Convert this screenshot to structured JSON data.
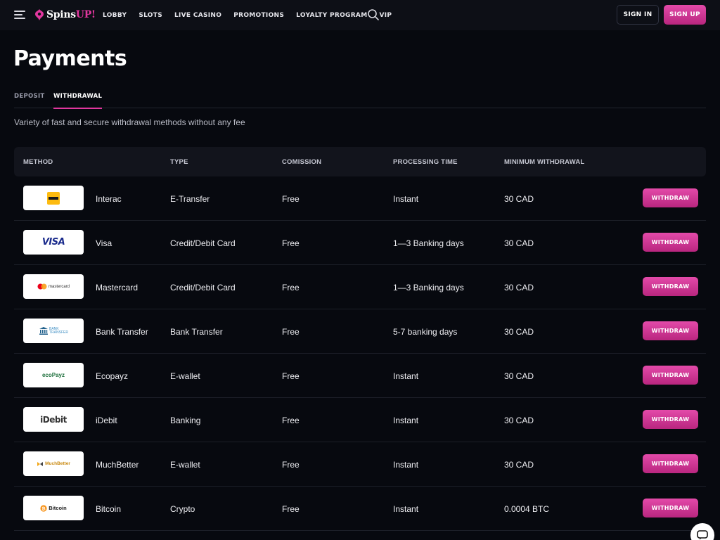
{
  "brand": {
    "name_part1": "Spins",
    "name_part2": "UP!",
    "accent": "#e1379e"
  },
  "nav": [
    "LOBBY",
    "SLOTS",
    "LIVE CASINO",
    "PROMOTIONS",
    "LOYALTY PROGRAM",
    "VIP"
  ],
  "header": {
    "sign_in": "SIGN IN",
    "sign_up": "SIGN UP"
  },
  "page": {
    "title": "Payments",
    "tabs": [
      "DEPOSIT",
      "WITHDRAWAL"
    ],
    "active_tab": "WITHDRAWAL",
    "subtitle": "Variety of fast and secure withdrawal methods without any fee"
  },
  "table": {
    "headers": [
      "METHOD",
      "TYPE",
      "COMISSION",
      "PROCESSING TIME",
      "MINIMUM WITHDRAWAL"
    ],
    "button_label": "WITHDRAW",
    "rows": [
      {
        "name": "Interac",
        "type": "E-Transfer",
        "commission": "Free",
        "time": "Instant",
        "min": "30 CAD",
        "logo": "interac-logo"
      },
      {
        "name": "Visa",
        "type": "Credit/Debit Card",
        "commission": "Free",
        "time": "1—3 Banking days",
        "min": "30 CAD",
        "logo": "visa-logo",
        "logo_text": "VISA"
      },
      {
        "name": "Mastercard",
        "type": "Credit/Debit Card",
        "commission": "Free",
        "time": "1—3 Banking days",
        "min": "30 CAD",
        "logo": "mastercard-logo",
        "logo_text": "mastercard"
      },
      {
        "name": "Bank Transfer",
        "type": "Bank Transfer",
        "commission": "Free",
        "time": "5-7 banking days",
        "min": "30 CAD",
        "logo": "bank-transfer-logo",
        "logo_text": "BANK TRANSFER"
      },
      {
        "name": "Ecopayz",
        "type": "E-wallet",
        "commission": "Free",
        "time": "Instant",
        "min": "30 CAD",
        "logo": "ecopayz-logo",
        "logo_text": "ecoPayz"
      },
      {
        "name": "iDebit",
        "type": "Banking",
        "commission": "Free",
        "time": "Instant",
        "min": "30 CAD",
        "logo": "idebit-logo",
        "logo_text": "iDebit"
      },
      {
        "name": "MuchBetter",
        "type": "E-wallet",
        "commission": "Free",
        "time": "Instant",
        "min": "30 CAD",
        "logo": "muchbetter-logo",
        "logo_text": "MuchBetter"
      },
      {
        "name": "Bitcoin",
        "type": "Crypto",
        "commission": "Free",
        "time": "Instant",
        "min": "0.0004 BTC",
        "logo": "bitcoin-logo",
        "logo_text": "Bitcoin"
      }
    ]
  }
}
